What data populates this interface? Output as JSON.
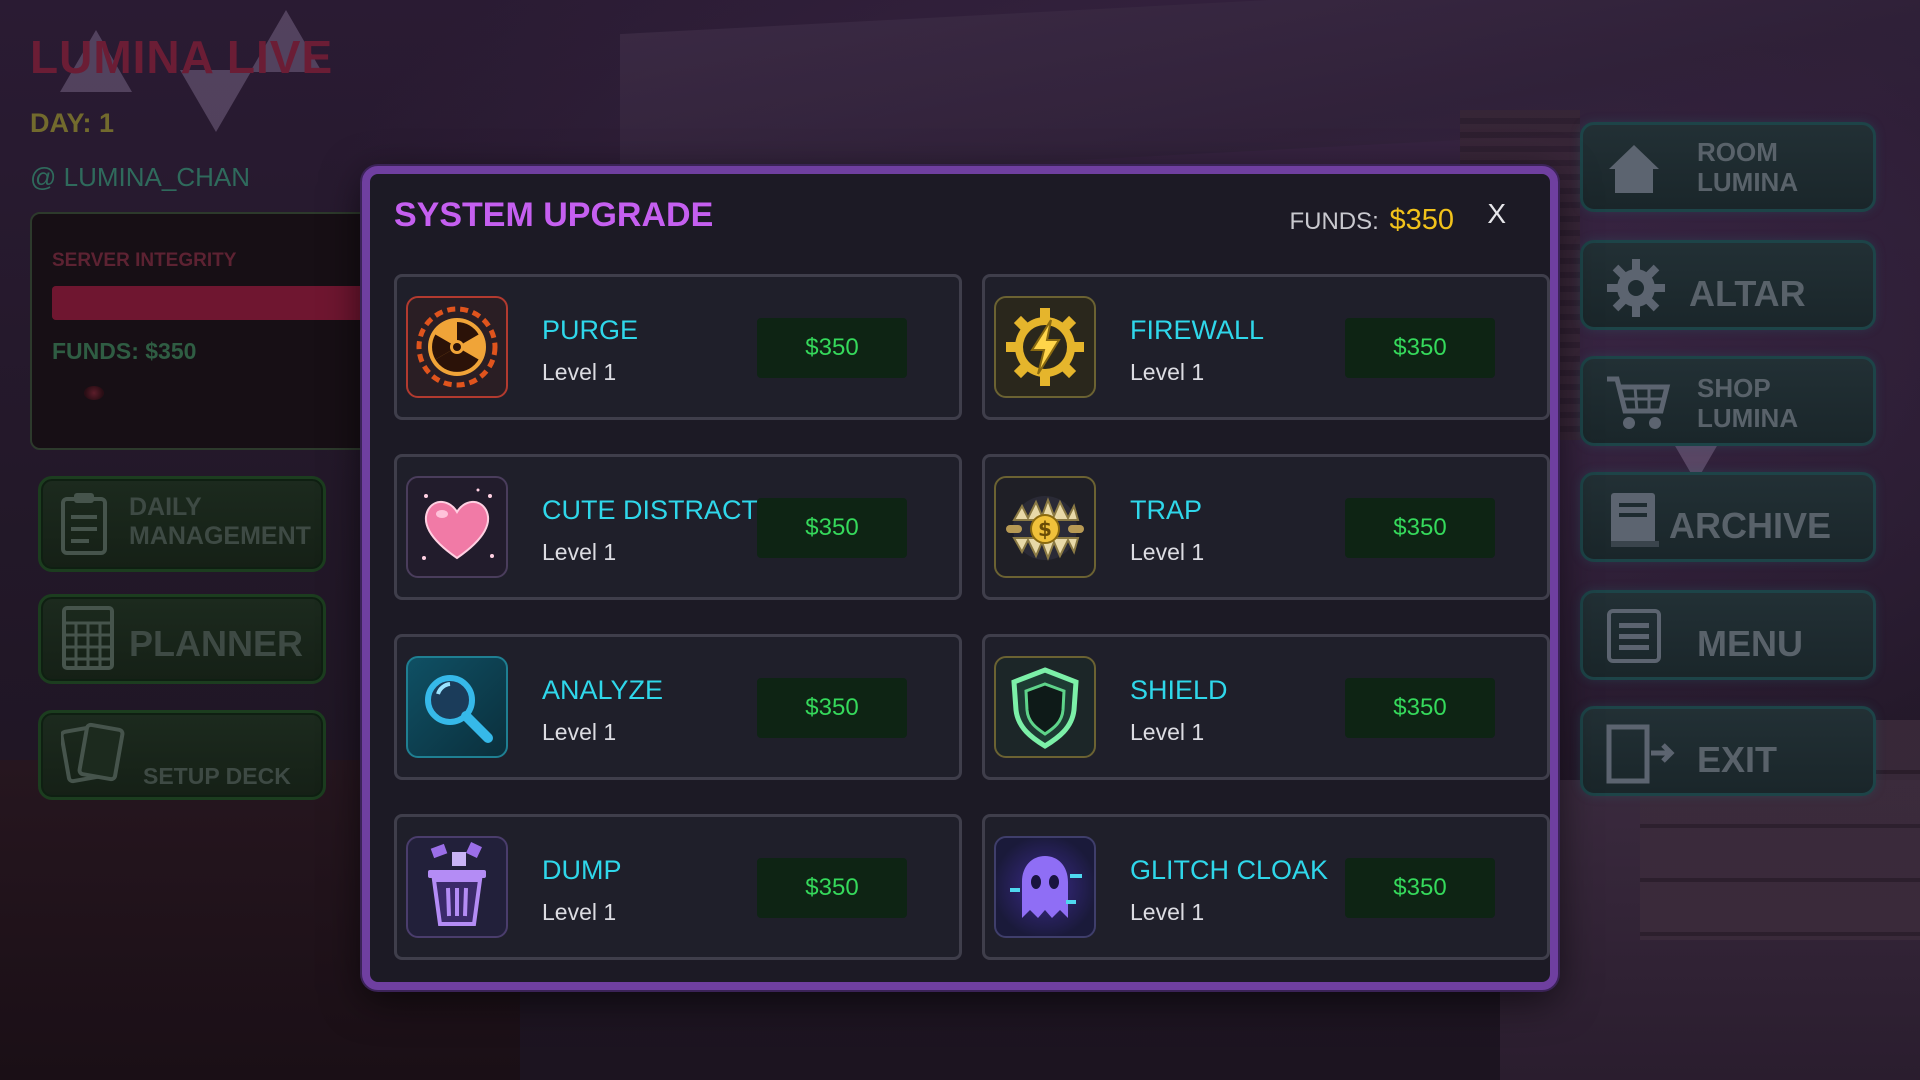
{
  "hud": {
    "game_title": "LUMINA LIVE",
    "day": "DAY: 1",
    "handle": "@ LUMINA_CHAN",
    "server_integrity_label": "SERVER INTEGRITY",
    "server_integrity_level": 1.0,
    "funds": "FUNDS: $350",
    "left_buttons": [
      {
        "label_line1": "DAILY",
        "label_line2": "MANAGEMENT",
        "icon": "clipboard-icon"
      },
      {
        "label": "PLANNER",
        "icon": "calendar-icon"
      },
      {
        "label": "SETUP DECK",
        "icon": "cards-icon"
      }
    ],
    "right_buttons": [
      {
        "label_line1": "ROOM",
        "label_line2": "LUMINA",
        "icon": "house-icon"
      },
      {
        "label": "ALTAR",
        "icon": "gear-icon"
      },
      {
        "label_line1": "SHOP",
        "label_line2": "LUMINA",
        "icon": "cart-icon"
      },
      {
        "label": "ARCHIVE",
        "icon": "book-icon"
      },
      {
        "label": "MENU",
        "icon": "list-icon"
      },
      {
        "label": "EXIT",
        "icon": "exit-door-icon"
      }
    ]
  },
  "modal": {
    "title": "SYSTEM UPGRADE",
    "funds_label": "FUNDS:",
    "funds_value": "$350",
    "close_label": "X",
    "upgrades": [
      {
        "name": "PURGE",
        "level": "Level 1",
        "price": "$350",
        "icon": "radiation-icon"
      },
      {
        "name": "FIREWALL",
        "level": "Level 1",
        "price": "$350",
        "icon": "lightning-gear-icon"
      },
      {
        "name": "CUTE DISTRACT",
        "level": "Level 1",
        "price": "$350",
        "icon": "heart-icon"
      },
      {
        "name": "TRAP",
        "level": "Level 1",
        "price": "$350",
        "icon": "bear-trap-coin-icon"
      },
      {
        "name": "ANALYZE",
        "level": "Level 1",
        "price": "$350",
        "icon": "magnifier-icon"
      },
      {
        "name": "SHIELD",
        "level": "Level 1",
        "price": "$350",
        "icon": "shield-icon"
      },
      {
        "name": "DUMP",
        "level": "Level 1",
        "price": "$350",
        "icon": "trash-icon"
      },
      {
        "name": "GLITCH CLOAK",
        "level": "Level 1",
        "price": "$350",
        "icon": "ghost-icon"
      }
    ]
  },
  "colors": {
    "modal_border": "#6f3fa0",
    "title_purple": "#c55ff0",
    "name_cyan": "#2fd7ea",
    "price_green": "#35d95b",
    "funds_gold": "#f1c21b"
  }
}
